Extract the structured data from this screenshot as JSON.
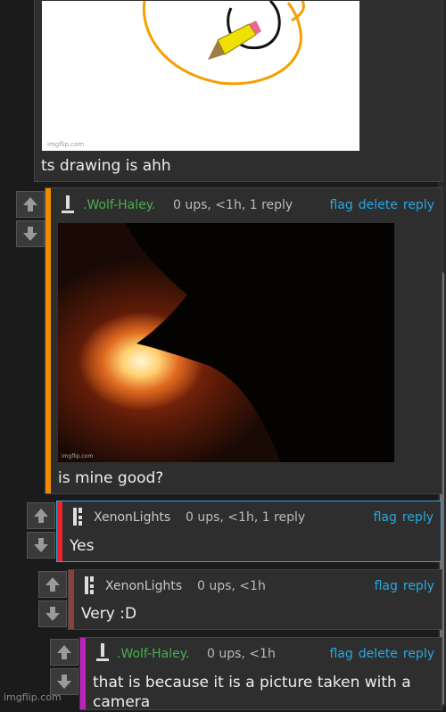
{
  "comments": [
    {
      "text": "ts drawing is ahh",
      "image_watermark": "imgflip.com"
    },
    {
      "username": ".Wolf-Haley.",
      "meta": "0 ups, <1h, 1 reply",
      "flag": "flag",
      "delete": "delete",
      "reply": "reply",
      "text": "is mine good?",
      "image_watermark": "imgflip.com",
      "bar_color": "#f08a00"
    },
    {
      "username": "XenonLights",
      "meta": "0 ups, <1h, 1 reply",
      "flag": "flag",
      "reply": "reply",
      "text": "Yes",
      "bar_color": "#e8242a"
    },
    {
      "username": "XenonLights",
      "meta": "0 ups, <1h",
      "flag": "flag",
      "reply": "reply",
      "text": "Very :D",
      "bar_color": "#8b4040"
    },
    {
      "username": ".Wolf-Haley.",
      "meta": "0 ups, <1h",
      "flag": "flag",
      "delete": "delete",
      "reply": "reply",
      "text": "that is because it is a picture taken with a camera",
      "bar_color": "#c020c0"
    }
  ],
  "watermark": "imgflip.com",
  "colors": {
    "link": "#29a8e0",
    "username_green": "#47b04b"
  }
}
